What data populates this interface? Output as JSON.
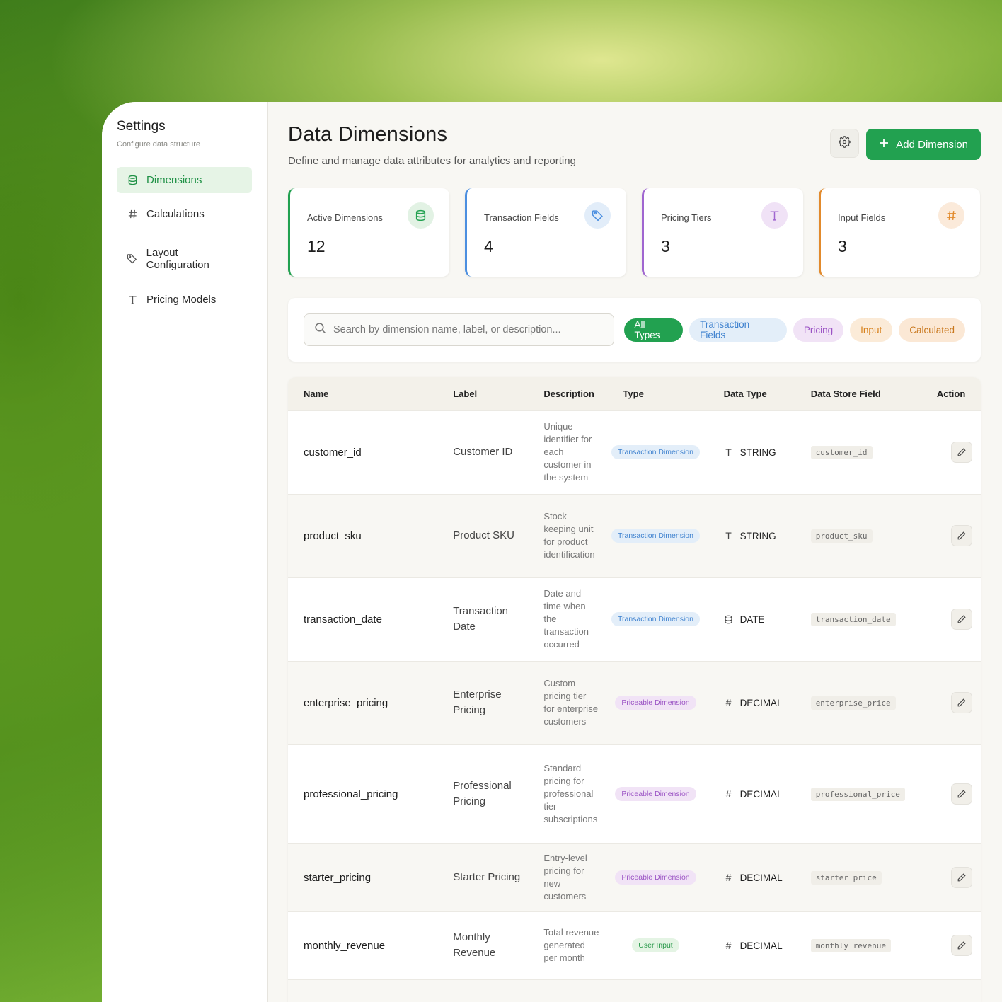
{
  "sidebar": {
    "title": "Settings",
    "subtitle": "Configure data structure",
    "items": [
      {
        "label": "Dimensions",
        "icon": "database-icon",
        "active": true
      },
      {
        "label": "Calculations",
        "icon": "hash-icon"
      },
      {
        "label": "Layout Configuration",
        "icon": "tag-icon"
      },
      {
        "label": "Pricing Models",
        "icon": "type-icon"
      }
    ]
  },
  "header": {
    "title": "Data Dimensions",
    "subtitle": "Define and manage data attributes for analytics and reporting",
    "add_label": "Add Dimension"
  },
  "stats": [
    {
      "label": "Active Dimensions",
      "value": "12",
      "color": "#22a150",
      "icon": "database-icon"
    },
    {
      "label": "Transaction Fields",
      "value": "4",
      "color": "#4c8fe0",
      "icon": "tag-icon"
    },
    {
      "label": "Pricing Tiers",
      "value": "3",
      "color": "#a066d0",
      "icon": "type-icon"
    },
    {
      "label": "Input Fields",
      "value": "3",
      "color": "#e28a2c",
      "icon": "hash-icon"
    }
  ],
  "search": {
    "placeholder": "Search by dimension name, label, or description..."
  },
  "filters": [
    "All Types",
    "Transaction Fields",
    "Pricing",
    "Input",
    "Calculated"
  ],
  "table": {
    "headers": [
      "Name",
      "Label",
      "Description",
      "Type",
      "Data Type",
      "Data Store Field",
      "Action"
    ],
    "rows": [
      {
        "name": "customer_id",
        "label": "Customer ID",
        "description": "Unique identifier for each customer in the system",
        "type": "Transaction Dimension",
        "data_type": "STRING",
        "store": "customer_id"
      },
      {
        "name": "product_sku",
        "label": "Product SKU",
        "description": "Stock keeping unit for product identification",
        "type": "Transaction Dimension",
        "data_type": "STRING",
        "store": "product_sku"
      },
      {
        "name": "transaction_date",
        "label": "Transaction Date",
        "description": "Date and time when the transaction occurred",
        "type": "Transaction Dimension",
        "data_type": "DATE",
        "store": "transaction_date"
      },
      {
        "name": "enterprise_pricing",
        "label": "Enterprise Pricing",
        "description": "Custom pricing tier for enterprise customers",
        "type": "Priceable Dimension",
        "data_type": "DECIMAL",
        "store": "enterprise_price"
      },
      {
        "name": "professional_pricing",
        "label": "Professional Pricing",
        "description": "Standard pricing for professional tier subscriptions",
        "type": "Priceable Dimension",
        "data_type": "DECIMAL",
        "store": "professional_price"
      },
      {
        "name": "starter_pricing",
        "label": "Starter Pricing",
        "description": "Entry-level pricing for new customers",
        "type": "Priceable Dimension",
        "data_type": "DECIMAL",
        "store": "starter_price"
      },
      {
        "name": "monthly_revenue",
        "label": "Monthly Revenue",
        "description": "Total revenue generated per month",
        "type": "User Input",
        "data_type": "DECIMAL",
        "store": "monthly_revenue"
      }
    ]
  }
}
